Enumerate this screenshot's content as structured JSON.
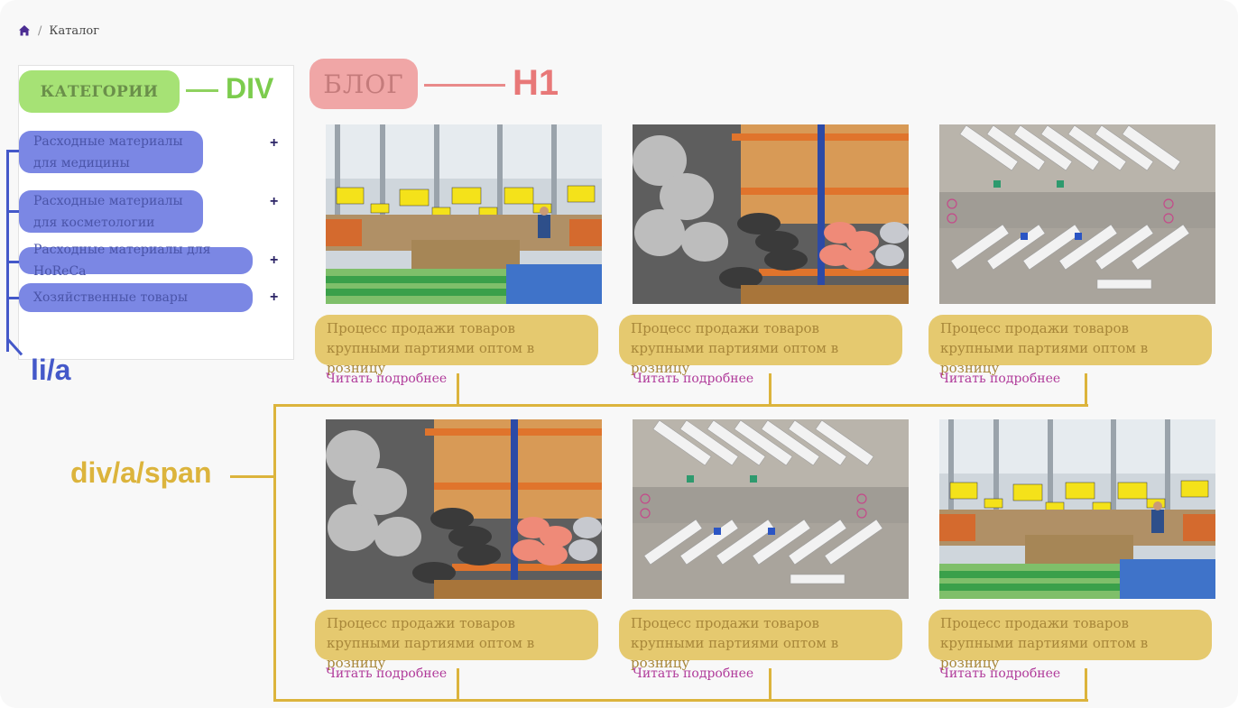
{
  "breadcrumb": {
    "home_icon": "home-icon",
    "separator": "/",
    "current": "Каталог"
  },
  "sidebar": {
    "heading": "КАТЕГОРИИ",
    "items": [
      {
        "label": "Расходные материалы для медицины",
        "expand": "+"
      },
      {
        "label": "Расходные материалы для косметологии",
        "expand": "+"
      },
      {
        "label": "Расходные материалы для HoReCa",
        "expand": "+"
      },
      {
        "label": "Хозяйственные товары",
        "expand": "+"
      }
    ]
  },
  "blog": {
    "title": "БЛОГ"
  },
  "annotations": {
    "div": "DIV",
    "h1": "H1",
    "li_a": "li/a",
    "div_a_span": "div/a/span"
  },
  "cards": [
    {
      "image": "store-interior",
      "title": "Процесс продажи товаров крупными партиями оптом в розницу",
      "link": "Читать подробнее"
    },
    {
      "image": "warehouse-rolls",
      "title": "Процесс продажи товаров крупными партиями оптом в розницу",
      "link": "Читать подробнее"
    },
    {
      "image": "trucks-aerial",
      "title": "Процесс продажи товаров крупными партиями оптом в розницу",
      "link": "Читать подробнее"
    },
    {
      "image": "warehouse-rolls",
      "title": "Процесс продажи товаров крупными партиями оптом в розницу",
      "link": "Читать подробнее"
    },
    {
      "image": "trucks-aerial",
      "title": "Процесс продажи товаров крупными партиями оптом в розницу",
      "link": "Читать подробнее"
    },
    {
      "image": "store-interior",
      "title": "Процесс продажи товаров крупными партиями оптом в розницу",
      "link": "Читать подробнее"
    }
  ],
  "colors": {
    "category_green": "#a6e275",
    "item_blue": "#7b87e4",
    "blog_pink": "#f0a6a6",
    "card_gold": "#e5c96f",
    "link_magenta": "#b03a9a"
  }
}
